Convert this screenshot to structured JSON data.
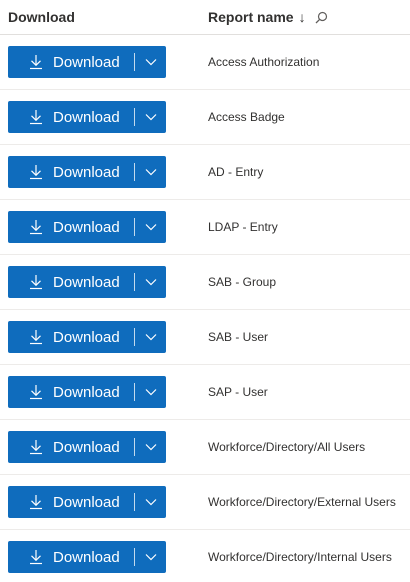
{
  "header": {
    "download_label": "Download",
    "report_name_label": "Report name",
    "sort_indicator": "↓",
    "search_icon": "search-icon"
  },
  "rows": [
    {
      "button_label": "Download",
      "report_name": "Access Authorization"
    },
    {
      "button_label": "Download",
      "report_name": "Access Badge"
    },
    {
      "button_label": "Download",
      "report_name": "AD - Entry"
    },
    {
      "button_label": "Download",
      "report_name": "LDAP - Entry"
    },
    {
      "button_label": "Download",
      "report_name": "SAB - Group"
    },
    {
      "button_label": "Download",
      "report_name": "SAB - User"
    },
    {
      "button_label": "Download",
      "report_name": "SAP - User"
    },
    {
      "button_label": "Download",
      "report_name": "Workforce/Directory/All Users"
    },
    {
      "button_label": "Download",
      "report_name": "Workforce/Directory/External Users"
    },
    {
      "button_label": "Download",
      "report_name": "Workforce/Directory/Internal Users"
    }
  ],
  "colors": {
    "button_bg": "#0f6cbd",
    "header_text": "#323130",
    "divider": "#edebe9"
  }
}
